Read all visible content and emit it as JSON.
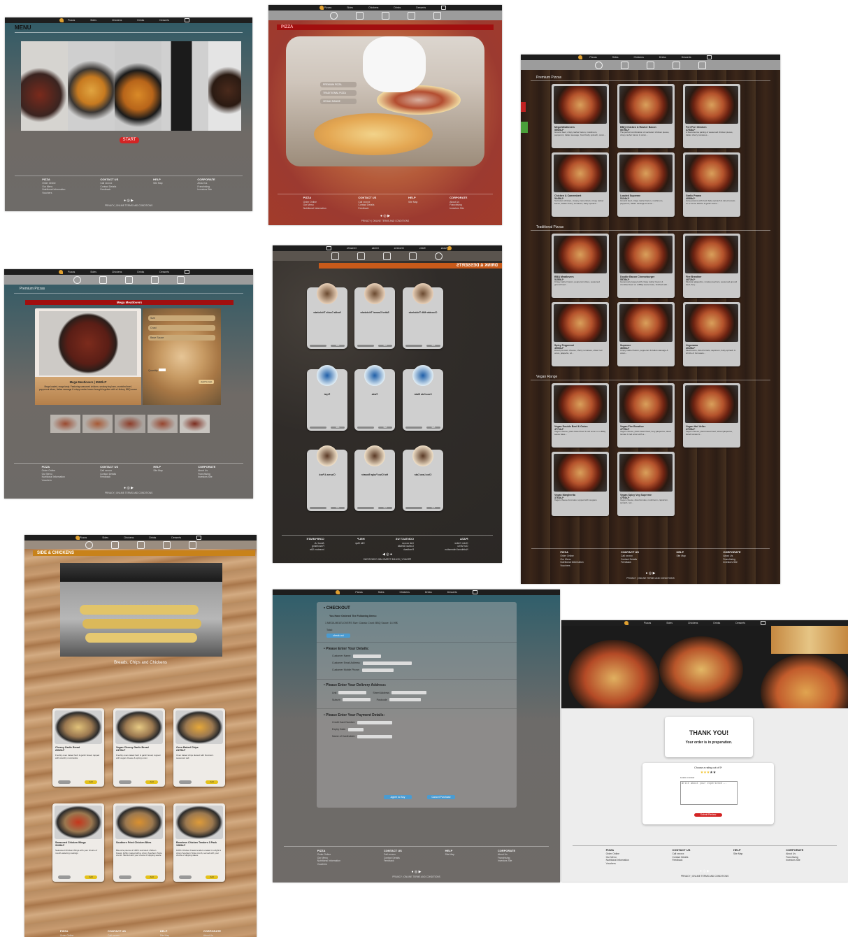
{
  "nav": {
    "items": [
      "Pizzas",
      "Sides",
      "Chickens",
      "Drinks",
      "Desserts"
    ]
  },
  "footer": {
    "pizza": {
      "heading": "PIZZA",
      "links": [
        "Order Online",
        "Our Menu",
        "Nutritional Information",
        "Vouchers"
      ]
    },
    "contact": {
      "heading": "CONTACT US",
      "links": [
        "Call xxxxxx",
        "Contact Details",
        "Feedback"
      ]
    },
    "help": {
      "heading": "HELP",
      "links": [
        "Site Map"
      ]
    },
    "corporate": {
      "heading": "CORPORATE",
      "links": [
        "About Us",
        "Franchising",
        "Investors Site"
      ]
    },
    "legal": "PRIVACY | ONLINE TERMS AND CONDITIONS"
  },
  "menu_screen": {
    "title": "MENU",
    "start_label": "START"
  },
  "pizza_screen": {
    "title": "PIZZA",
    "options": [
      "PREMIUM PIZZA",
      "TRADITIONAL PIZZA",
      "VEGAN RANGE"
    ]
  },
  "product_screen": {
    "section": "Premium Pizzas",
    "product_title": "Mega Meatlovers",
    "name": "Mega Meatlovers | 5592kJ*",
    "desc": "Mega loaded, mega tasty. Featuring seasoned chicken, smokey leg ham, crumbled beef, pepperoni slices, Italian sausage & crispy rasher bacon brought together with a Hickory BBQ sauce",
    "selects": [
      "Size",
      "Crust",
      "Base Sauce"
    ],
    "quantity_label": "Quantity",
    "add_label": "Add To Cart"
  },
  "drinks_screen": {
    "title": "DRINK & DESSERTS",
    "rows": [
      [
        "Chocolate Milk Thickshake",
        "Salted Caramel Thickshake",
        "Vanilla Cookie Thickshake"
      ],
      [
        "Coca-Cola Water",
        "Fanta",
        "Pepsi"
      ],
      [
        "Choc Lava Cake",
        "Hot Choc Fudge Brownie",
        "Churros 4 Pack"
      ]
    ],
    "add": "Add"
  },
  "menu_list": {
    "sections": [
      {
        "title": "Premium Pizzas",
        "items": [
          {
            "name": "Mega Meatlovers",
            "kj": "5592kJ*",
            "desc": "Ground beef, crispy rasher bacon, mushroom, pepperoni, Italian sausage, fresh baby spinach, onion..."
          },
          {
            "name": "BBQ Chicken & Rasher Bacon",
            "kj": "5075kJ*",
            "desc": "The perfect combination of succulent chicken pieces, crispy rasher bacon & onion..."
          },
          {
            "name": "Peri Peri Chicken",
            "kj": "4753kJ*",
            "desc": "A flavoursome pairing of seasoned chicken pieces, Italian cherry tomatoes..."
          },
          {
            "name": "Chicken & Camembert",
            "kj": "5445kJ*",
            "desc": "Succulent chicken, creamy camembert, crispy rasher bacon, Italian cherry tomatoes, baby spinach..."
          },
          {
            "name": "Loaded Supreme",
            "kj": "5134kJ*",
            "desc": "Ground beef, crispy rasher bacon, mushroom, pepperoni, Italian sausage & onion..."
          },
          {
            "name": "Garlic Prawn",
            "kj": "4059kJ*",
            "desc": "Juicy prawns with fresh baby spinach & diced tomato on a crème fraîche & garlic sauce..."
          }
        ]
      },
      {
        "title": "Traditional Pizzas",
        "items": [
          {
            "name": "BBQ Meatlovers",
            "kj": "5150kJ*",
            "desc": "Crispy rasher bacon, pepperoni slices, seasoned ground beef..."
          },
          {
            "name": "Double Bacon Cheeseburger",
            "kj": "5578kJ*",
            "desc": "Generously topped with crispy rasher bacon & crumbled beef on a BBQ sauce base, finished with..."
          },
          {
            "name": "Fire Breather",
            "kj": "4872kJ*",
            "desc": "Mexican jalapeños, smokey leg ham, seasoned ground beef, fiery..."
          },
          {
            "name": "Spicy Pepperoni",
            "kj": "4906kJ*",
            "desc": "Diced premium cheese, cherry tomatoes, sliced red onion, jalapeño, oil..."
          },
          {
            "name": "Supreme",
            "kj": "4606kJ*",
            "desc": "Crispy rasher bacon, pepperoni & Italian sausage & onion..."
          },
          {
            "name": "Vegorama",
            "kj": "4015kJ*",
            "desc": "Mushrooms, diced tomato, capsicum, baby spinach & drizzle of hot sauce..."
          }
        ]
      },
      {
        "title": "Vegan Range",
        "items": [
          {
            "name": "Vegan Double Beef & Onion",
            "kj": "4771kJ*",
            "desc": "Vegan cheese, plant-based beef & red onion on a BBQ sauce base..."
          },
          {
            "name": "Vegan Fire Breather",
            "kj": "4779kJ*",
            "desc": "Vegan cheese, plant-based beef, fiery jalapeños, diced tomato & red onion with a..."
          },
          {
            "name": "Vegan Hot Veller",
            "kj": "4729kJ*",
            "desc": "Vegan cheese, plant-based beef, sliced jalapeños, diced tomato &..."
          },
          {
            "name": "Vegan Margherita",
            "kj": "3764kJ*",
            "desc": "Vegan cheese & tomato, topped with oregano"
          },
          {
            "name": "Vegan Spicy Veg Supreme",
            "kj": "4754kJ*",
            "desc": "Vegan cheese, diced tomato, mushroom, capsicum, spinach, red..."
          }
        ]
      }
    ]
  },
  "sides_screen": {
    "title": "SIDE & CHICKENS",
    "heading": "Breads, Chips and Chickens",
    "items": [
      {
        "name": "Cheesy Garlic Bread",
        "kj": "2602kJ*",
        "desc": "Freshly oven baked herb & garlic bread, topped with stretchy mozzarella"
      },
      {
        "name": "Vegan Cheesy Garlic Bread",
        "kj": "2470kJ*",
        "desc": "Freshly oven-baked herb & garlic bread, topped with vegan cheese & spring onion"
      },
      {
        "name": "Oven Baked Chips",
        "kj": "2475kJ*",
        "desc": "Oven baked chips dusted with Domino's seasoned salt"
      },
      {
        "name": "Seasoned Chicken Wings",
        "kj": "3128kJ*",
        "desc": "Seasoned Chicken Wings with your choice of mouth-watering coatings"
      },
      {
        "name": "Southern Fried Chicken Bites",
        "kj": "",
        "desc": "Bite-size pieces of 100% succulent chicken breast, lightly coated with a crispy Southern Style crumb. Served with your choice of dipping sauce"
      },
      {
        "name": "Boneless Chicken Tenders 3 Pack",
        "kj": "1983kJ*",
        "desc": "100% Chicken breast tenders coated in a light & crispy Southern Style crumb, served with your choice of dipping sauce"
      }
    ],
    "add": "Add"
  },
  "checkout_screen": {
    "title": "CHECKOUT",
    "ordered": "You Have Ordered The Following Items:",
    "line": "1 MEGA MEATLOVERS Size: Classic Crust: BBQ Sauce: 14.99$",
    "total": "Total:",
    "check": "check out",
    "details": "Please Enter Your Details:",
    "detail_fields": [
      "Customer Name:",
      "Customer Email Address:",
      "Customer Mobile Phone:"
    ],
    "address": "Please Enter Your Delivery Address:",
    "address_fields": [
      "Unit",
      "Street Address",
      "Suburb",
      "Postcode"
    ],
    "payment": "Please Enter Your Payment Details:",
    "payment_fields": [
      "Credit Card Number:",
      "Expiry Date:",
      "Name of Cardholder:"
    ],
    "agree": "Agree to Buy",
    "cancel": "Cancel Purchase"
  },
  "thanks_screen": {
    "title": "THANK YOU!",
    "sub": "Your order is in preperation.",
    "rating": "Choose a rating out of 5*",
    "review_label": "Leave a review",
    "review_placeholder": "Write about your experience...",
    "submit": "Submit Review"
  }
}
